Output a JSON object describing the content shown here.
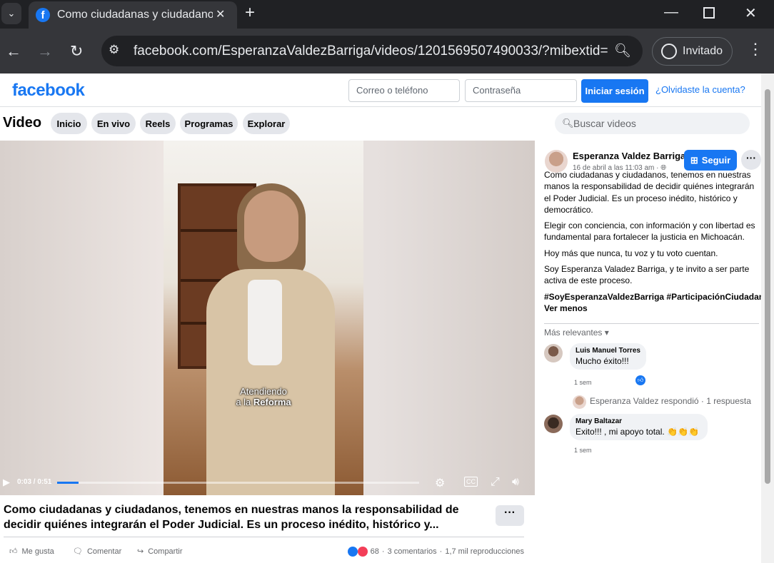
{
  "browser": {
    "tab_title": "Como ciudadanas y ciudadanos, te",
    "url": "facebook.com/EsperanzaValdezBarriga/videos/1201569507490033/?mibextid=wwXI...",
    "guest_label": "Invitado"
  },
  "header": {
    "logo": "facebook",
    "email_placeholder": "Correo o teléfono",
    "password_placeholder": "Contraseña",
    "login_label": "Iniciar sesión",
    "forgot_label": "¿Olvidaste la cuenta?"
  },
  "video_nav": {
    "title": "Video",
    "tabs": [
      "Inicio",
      "En vivo",
      "Reels",
      "Programas",
      "Explorar"
    ],
    "search_placeholder": "Buscar videos"
  },
  "player": {
    "caption_line1": "Atendiendo",
    "caption_line2_a": "a la ",
    "caption_line2_b": "Reforma",
    "time": "0:03 / 0:51",
    "progress": 0.06,
    "buffered": 0.94
  },
  "post": {
    "author": "Esperanza Valdez Barriga",
    "date": "16 de abril a las 11:03 am · ",
    "follow_label": "Seguir",
    "paragraphs": [
      "Como ciudadanas y ciudadanos, tenemos en nuestras manos la responsabilidad de decidir quiénes integrarán el Poder Judicial. Es un proceso inédito, histórico y democrático.",
      "Elegir con conciencia, con información y con libertad es fundamental para fortalecer la justicia en Michoacán.",
      "Hoy más que nunca, tu voz y tu voto cuentan.",
      "Soy Esperanza Valadez Barriga, y te invito a ser parte activa de este proceso."
    ],
    "lines": [
      [
        "Como ciudadanas y ciudadanos, tenemos en nuestras",
        "manos la responsabilidad de decidir quiénes integrarán",
        "el Poder Judicial. Es un proceso inédito, histórico y",
        "democrático."
      ],
      [
        "Elegir con conciencia, con información y con libertad es",
        "fundamental para fortalecer la justicia en Michoacán."
      ],
      [
        "Hoy más que nunca, tu voz y tu voto cuentan."
      ],
      [
        "Soy Esperanza Valadez Barriga, y te invito a ser parte",
        "activa de este proceso."
      ]
    ],
    "hashtags": "#SoyEsperanzaValdezBarriga #ParticipaciónCiudadana",
    "see_less": "Ver menos"
  },
  "comments": {
    "sort_label": "Más relevantes",
    "items": [
      {
        "name": "Luis Manuel Torres",
        "text": "Mucho éxito!!!",
        "time": "1 sem"
      },
      {
        "name": "Mary Baltazar",
        "text": "Exito!!! , mi apoyo total. 👏👏👏",
        "time": "1 sem"
      }
    ],
    "reply_summary": "Esperanza Valdez respondió · 1 respuesta"
  },
  "info": {
    "title": "Como ciudadanas y ciudadanos, tenemos en nuestras manos la responsabilidad de decidir quiénes integrarán el Poder Judicial. Es un proceso inédito, histórico y...",
    "like_label": "Me gusta",
    "comment_label": "Comentar",
    "share_label": "Compartir",
    "reactions": "68",
    "comments_count": "3 comentarios",
    "views": "1,7 mil reproducciones"
  },
  "colors": {
    "brand": "#1877f2"
  }
}
